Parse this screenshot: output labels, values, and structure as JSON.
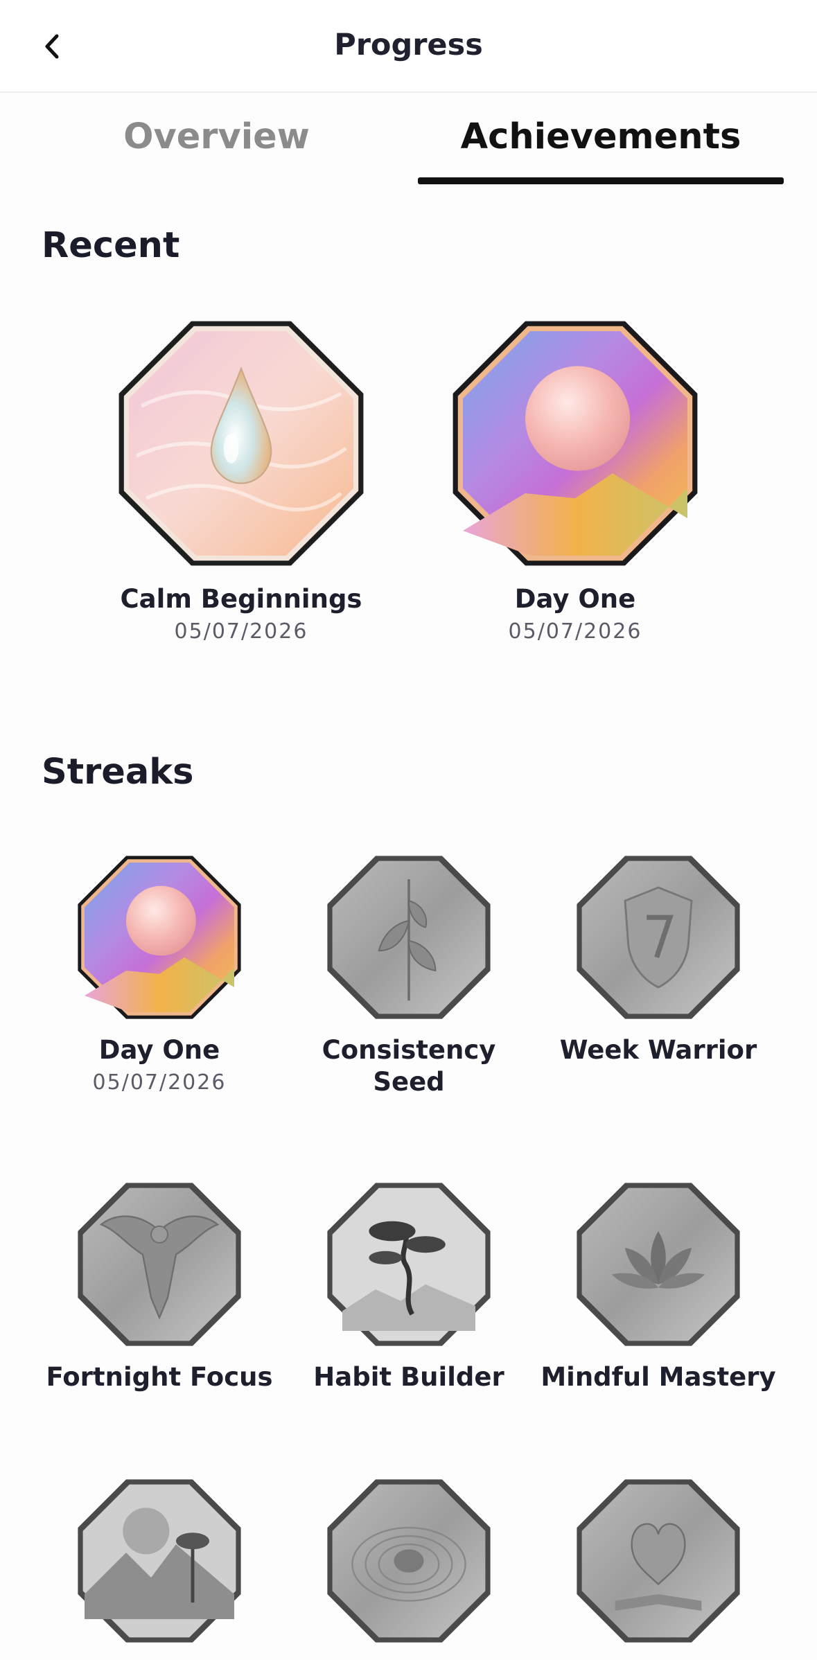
{
  "header": {
    "title": "Progress",
    "back_icon": "chevron-left-icon"
  },
  "tabs": [
    {
      "label": "Overview",
      "active": false
    },
    {
      "label": "Achievements",
      "active": true
    }
  ],
  "recent": {
    "title": "Recent",
    "items": [
      {
        "name": "Calm Beginnings",
        "date": "05/07/2026",
        "unlocked": true,
        "icon": "water-drop-icon"
      },
      {
        "name": "Day One",
        "date": "05/07/2026",
        "unlocked": true,
        "icon": "sunrise-orb-icon"
      }
    ]
  },
  "streaks": {
    "title": "Streaks",
    "items": [
      {
        "name": "Day One",
        "date": "05/07/2026",
        "unlocked": true,
        "icon": "sunrise-orb-icon"
      },
      {
        "name": "Consistency Seed",
        "unlocked": false,
        "icon": "leaf-sprout-icon"
      },
      {
        "name": "Week Warrior",
        "unlocked": false,
        "icon": "shield-seven-icon"
      },
      {
        "name": "Fortnight Focus",
        "unlocked": false,
        "icon": "eagle-icon"
      },
      {
        "name": "Habit Builder",
        "unlocked": false,
        "icon": "bonsai-tree-icon"
      },
      {
        "name": "Mindful Mastery",
        "unlocked": false,
        "icon": "lotus-icon"
      },
      {
        "name": "",
        "unlocked": false,
        "icon": "mountain-moon-icon"
      },
      {
        "name": "",
        "unlocked": false,
        "icon": "ripple-icon"
      },
      {
        "name": "",
        "unlocked": false,
        "icon": "open-book-icon"
      }
    ]
  },
  "colors": {
    "accent": "#111111",
    "inactive_tab": "#8b8b8b",
    "locked": "#8a8a8a"
  }
}
